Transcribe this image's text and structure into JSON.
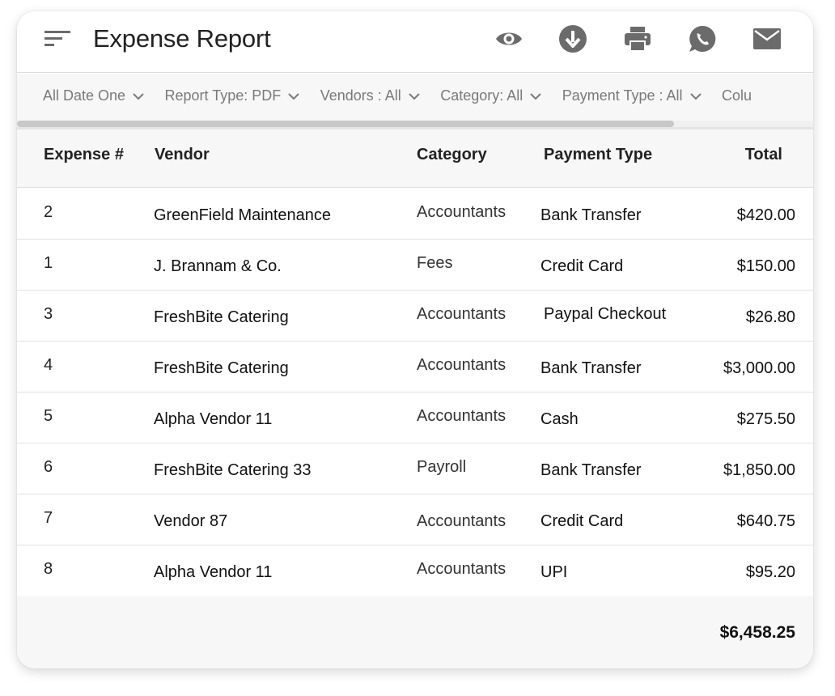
{
  "header": {
    "title": "Expense Report",
    "icons": [
      "menu-icon",
      "eye-icon",
      "download-icon",
      "print-icon",
      "whatsapp-icon",
      "mail-icon"
    ]
  },
  "filters": [
    "All Date One",
    "Report Type: PDF",
    "Vendors : All",
    "Category: All",
    "Payment Type : All",
    "Colu"
  ],
  "table": {
    "columns": [
      "Expense #",
      "Vendor",
      "Category",
      "Payment Type",
      "Total"
    ],
    "rows": [
      {
        "num": "2",
        "vendor": "GreenField Maintenance",
        "category": "Accountants",
        "payment": "Bank Transfer",
        "total": "$420.00"
      },
      {
        "num": "1",
        "vendor": "J. Brannam & Co.",
        "category": "Fees",
        "payment": "Credit Card",
        "total": "$150.00"
      },
      {
        "num": "3",
        "vendor": "FreshBite Catering",
        "category": "Accountants",
        "payment": "Paypal Checkout",
        "total": "$26.80"
      },
      {
        "num": "4",
        "vendor": "FreshBite Catering",
        "category": "Accountants",
        "payment": "Bank Transfer",
        "total": "$3,000.00"
      },
      {
        "num": "5",
        "vendor": "Alpha Vendor 11",
        "category": "Accountants",
        "payment": "Cash",
        "total": "$275.50"
      },
      {
        "num": "6",
        "vendor": "FreshBite Catering 33",
        "category": "Payroll",
        "payment": "Bank Transfer",
        "total": "$1,850.00"
      },
      {
        "num": "7",
        "vendor": "Vendor 87",
        "category": "Accountants",
        "payment": "Credit Card",
        "total": "$640.75"
      },
      {
        "num": "8",
        "vendor": "Alpha Vendor 11",
        "category": "Accountants",
        "payment": "UPI",
        "total": "$95.20"
      }
    ],
    "grand_total": "$6,458.25"
  },
  "colors": {
    "icon": "#6b6b6b",
    "header_bg": "#f7f7f7",
    "border": "#dcdcdc"
  }
}
